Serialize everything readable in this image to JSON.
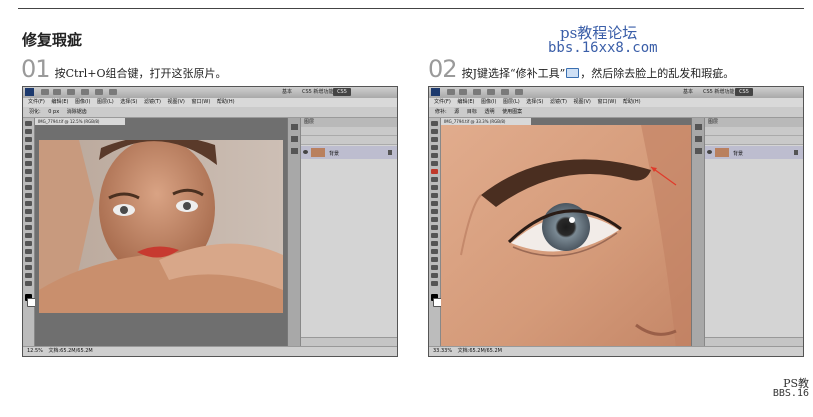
{
  "header": {
    "section_title": "修复瑕疵",
    "watermark_line1": "ps教程论坛",
    "watermark_line2": "bbs.16xx8.com"
  },
  "steps": [
    {
      "number": "01",
      "text": "按Ctrl+O组合键，打开这张原片。"
    },
    {
      "number": "02",
      "text_before_icon": "按J键选择“修补工具”",
      "icon": "patch-tool-icon",
      "text_after_icon": "，然后除去脸上的乱发和瑕疵。"
    }
  ],
  "corner_watermark": {
    "line1": "PS教",
    "line2": "BBS.16"
  },
  "photoshop": {
    "menu_items": [
      "文件(F)",
      "编辑(E)",
      "图像(I)",
      "图层(L)",
      "选择(S)",
      "滤镜(T)",
      "视图(V)",
      "窗口(W)",
      "帮助(H)"
    ],
    "essentials": "基本",
    "cs5_label": "CS5 新增功能",
    "layer_name": "背景",
    "panel_title": "图层",
    "window1": {
      "doc_tab": "IMG_7794.tif @ 12.5% (RGB/8)",
      "zoom": "12.5%",
      "doc_size": "文档:65.2M/65.2M",
      "options": [
        "羽化:",
        "0 px",
        "消除锯齿"
      ]
    },
    "window2": {
      "doc_tab": "IMG_7794.tif @ 33.3% (RGB/8)",
      "zoom": "33.33%",
      "doc_size": "文档:65.2M/65.2M",
      "options": [
        "修补:",
        "源",
        "目标",
        "透明",
        "使用图案"
      ]
    }
  },
  "colors": {
    "watermark": "#3a5ea8",
    "arrow": "#e03a2a"
  }
}
